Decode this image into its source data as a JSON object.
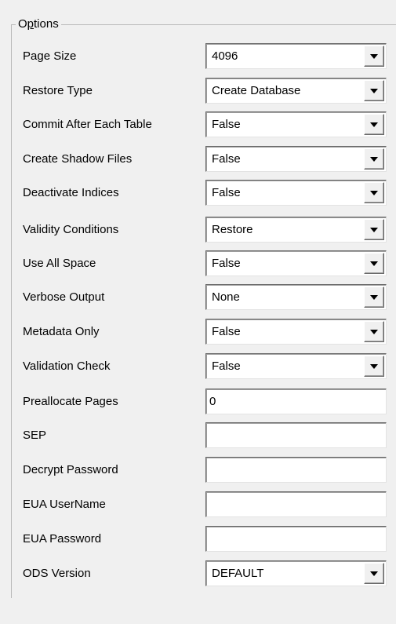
{
  "group": {
    "title_pre": "O",
    "title_accel": "p",
    "title_post": "tions"
  },
  "fields": {
    "page_size": {
      "label": "Page Size",
      "value": "4096"
    },
    "restore_type": {
      "label": "Restore Type",
      "value": "Create Database"
    },
    "commit_after_each_table": {
      "label": "Commit After Each Table",
      "value": "False"
    },
    "create_shadow_files": {
      "label": "Create Shadow Files",
      "value": "False"
    },
    "deactivate_indices": {
      "label": "Deactivate Indices",
      "value": "False"
    },
    "validity_conditions": {
      "label": "Validity Conditions",
      "value": "Restore"
    },
    "use_all_space": {
      "label": "Use All Space",
      "value": "False"
    },
    "verbose_output": {
      "label": "Verbose Output",
      "value": "None"
    },
    "metadata_only": {
      "label": "Metadata Only",
      "value": "False"
    },
    "validation_check": {
      "label": "Validation Check",
      "value": "False"
    },
    "preallocate_pages": {
      "label": "Preallocate Pages",
      "value": "0"
    },
    "sep": {
      "label": "SEP",
      "value": ""
    },
    "decrypt_password": {
      "label": "Decrypt Password",
      "value": ""
    },
    "eua_username": {
      "label": "EUA UserName",
      "value": ""
    },
    "eua_password": {
      "label": "EUA Password",
      "value": ""
    },
    "ods_version": {
      "label": "ODS Version",
      "value": "DEFAULT"
    }
  },
  "icons": {
    "dropdown": "chevron-down-icon"
  },
  "colors": {
    "background": "#f0f0f0",
    "field": "#ffffff",
    "border_dark": "#696969",
    "group_line": "#b9b9b9"
  }
}
